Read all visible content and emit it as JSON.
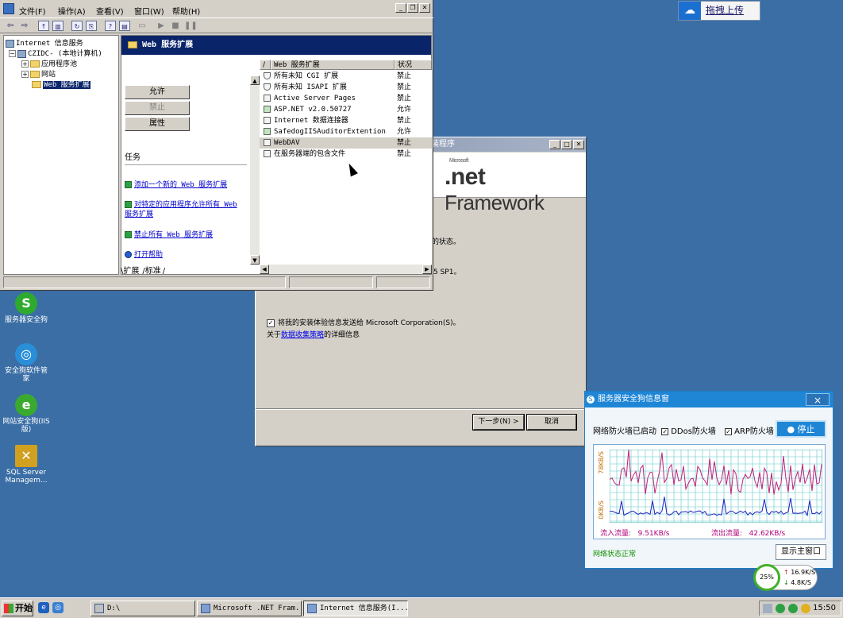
{
  "upload_widget": {
    "label": "拖拽上传",
    "icon": "cloud-upload-icon"
  },
  "desktop_icons": [
    {
      "name": "safedog-server-icon",
      "label": "服务器安全狗",
      "color": "#2eaa2e",
      "glyph": "S"
    },
    {
      "name": "safedog-manager-icon",
      "label": "安全狗软件管家",
      "color": "#2a8fd8",
      "glyph": "◎"
    },
    {
      "name": "website-safedog-icon",
      "label": "网站安全狗(IIS版)",
      "color": "#3aaa2e",
      "glyph": "e"
    },
    {
      "name": "sql-server-icon",
      "label": "SQL Server Managem...",
      "color": "#d0a020",
      "glyph": "✕"
    }
  ],
  "net_installer": {
    "title_fragment": "装程序",
    "logo_prefix": "Microsoft",
    "logo_net": ".net",
    "logo_framework": "Framework",
    "frag_status": "的状态。",
    "frag_sp": "5 SP1。",
    "checkbox_label": "将我的安装体验信息发送给 Microsoft Corporation(S)。",
    "privacy_prefix": "关于",
    "privacy_link": "数据收集策略",
    "privacy_suffix": "的详细信息",
    "next_button": "下一步(N) >",
    "cancel_button": "取消"
  },
  "iis": {
    "menu": [
      "文件(F)",
      "操作(A)",
      "查看(V)",
      "窗口(W)",
      "帮助(H)"
    ],
    "tree": {
      "root": "Internet 信息服务",
      "computer": "CZIDC- (本地计算机)",
      "app_pools": "应用程序池",
      "websites": "网站",
      "web_ext": "Web 服务扩展"
    },
    "header": "Web 服务扩展",
    "buttons": {
      "allow": "允许",
      "prohibit": "禁止",
      "properties": "属性"
    },
    "tasks_label": "任务",
    "tasks": [
      "添加一个新的 Web 服务扩展",
      "对特定的应用程序允许所有 Web 服务扩展",
      "禁止所有 Web 服务扩展",
      "打开帮助"
    ],
    "columns": {
      "name": "Web 服务扩展",
      "status": "状况"
    },
    "extensions": [
      {
        "name": "所有未知 CGI 扩展",
        "status": "禁止",
        "icon": "filter-icon"
      },
      {
        "name": "所有未知 ISAPI 扩展",
        "status": "禁止",
        "icon": "filter-icon"
      },
      {
        "name": "Active Server Pages",
        "status": "禁止",
        "icon": "extension-icon"
      },
      {
        "name": "ASP.NET v2.0.50727",
        "status": "允许",
        "icon": "extension-allowed-icon"
      },
      {
        "name": "Internet 数据连接器",
        "status": "禁止",
        "icon": "extension-icon"
      },
      {
        "name": "SafedogIISAuditorExtention",
        "status": "允许",
        "icon": "extension-allowed-icon"
      },
      {
        "name": "WebDAV",
        "status": "禁止",
        "icon": "extension-icon"
      },
      {
        "name": "在服务器端的包含文件",
        "status": "禁止",
        "icon": "extension-icon"
      }
    ],
    "tabs": [
      "扩展",
      "标准"
    ]
  },
  "safedog": {
    "title": "服务器安全狗信息窗",
    "close": "×",
    "firewall_started": "网络防火墙已启动",
    "ddos_label": "DDos防火墙",
    "arp_label": "ARP防火墙",
    "stop_button": "停止",
    "ymax_label": "78KB/S",
    "ymin_label": "0KB/S",
    "in_label": "流入流量:",
    "in_value": "9.51KB/s",
    "out_label": "流出流量:",
    "out_value": "42.62KB/s",
    "status": "网络状态正常",
    "main_button": "显示主窗口"
  },
  "net_meter": {
    "percent": "25%",
    "up": "16.9K/S",
    "down": "4.8K/S"
  },
  "taskbar": {
    "start": "开始",
    "items": [
      {
        "label": "D:\\"
      },
      {
        "label": "Microsoft .NET Fram..."
      },
      {
        "label": "Internet 信息服务(I..."
      }
    ],
    "clock": "15:50"
  }
}
